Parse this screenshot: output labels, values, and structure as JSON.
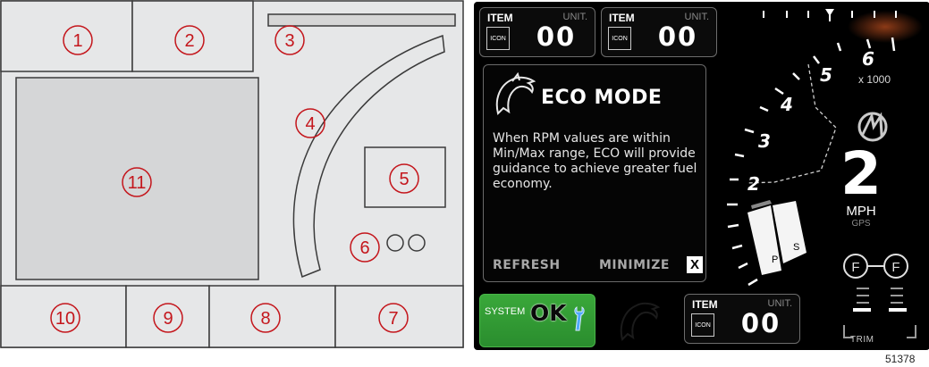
{
  "schematic": {
    "callouts": [
      "1",
      "2",
      "3",
      "4",
      "5",
      "6",
      "7",
      "8",
      "9",
      "10",
      "11"
    ]
  },
  "display": {
    "item_boxes": [
      {
        "title": "ITEM",
        "unit": "UNIT.",
        "icon": "ICON",
        "value": "00"
      },
      {
        "title": "ITEM",
        "unit": "UNIT.",
        "icon": "ICON",
        "value": "00"
      },
      {
        "title": "ITEM",
        "unit": "UNIT.",
        "icon": "ICON",
        "value": "00"
      }
    ],
    "eco": {
      "title": "ECO MODE",
      "description": "When RPM values are within Min/Max range, ECO will provide guidance to achieve greater fuel economy.",
      "refresh_label": "REFRESH",
      "minimize_label": "MINIMIZE",
      "close_label": "X",
      "icon": "dolphin-icon"
    },
    "system": {
      "label": "SYSTEM",
      "status": "OK",
      "status_icon": "wrench-icon",
      "color": "#2e9a34"
    },
    "tachometer": {
      "labels": [
        "2",
        "3",
        "4",
        "5",
        "6"
      ],
      "multiplier": "x 1000",
      "accent": "#ff6a2a"
    },
    "speed": {
      "value": "2",
      "unit": "MPH",
      "source": "GPS"
    },
    "gears": [
      "P",
      "S"
    ],
    "fuel_labels": [
      "F",
      "F"
    ],
    "trim_label": "TRIM",
    "brand_logo": "mercury-logo"
  },
  "figure_id": "51378"
}
